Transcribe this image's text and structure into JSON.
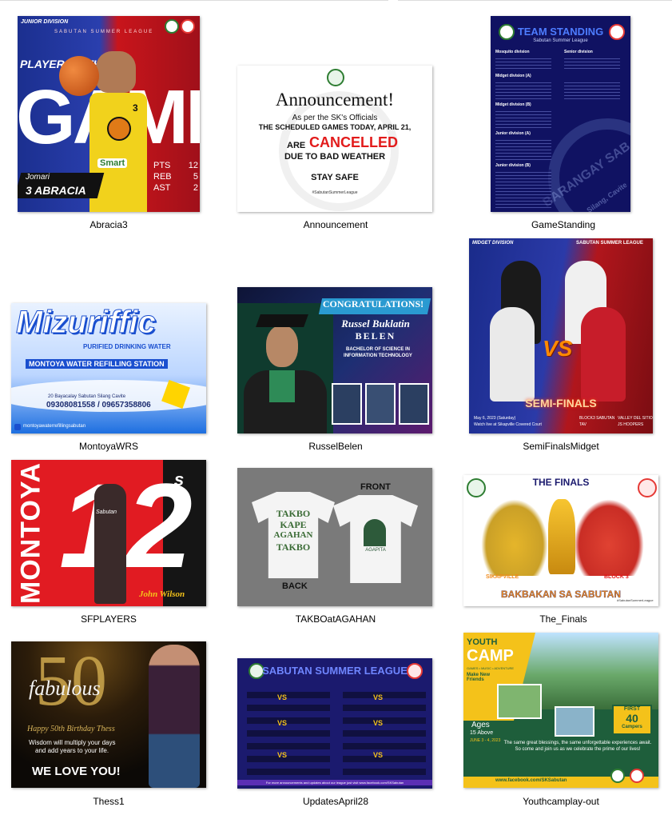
{
  "explorer": {
    "items": [
      {
        "name": "Abracia3",
        "art": {
          "division": "JUNIOR DIVISION",
          "league": "SABUTAN SUMMER LEAGUE",
          "headline": "PLAYER OF THE",
          "big_word": "GAME",
          "jersey_number": "3",
          "sponsor": "Smart",
          "first_name": "Jomari",
          "last_name": "3 ABRACIA",
          "stats": [
            {
              "label": "PTS",
              "value": "12"
            },
            {
              "label": "REB",
              "value": "5"
            },
            {
              "label": "AST",
              "value": "2"
            }
          ]
        }
      },
      {
        "name": "Announcement",
        "art": {
          "title": "Announcement!",
          "line1": "As per the SK's Officials",
          "line2": "THE SCHEDULED GAMES TODAY, APRIL 21,",
          "are": "ARE",
          "cancelled": "CANCELLED",
          "reason": "DUE TO BAD WEATHER",
          "stay_safe": "STAY SAFE",
          "hashtag": "#SabutanSummerLeague"
        }
      },
      {
        "name": "GameStanding",
        "art": {
          "title": "TEAM STANDING",
          "subtitle": "Sabutan Summer League",
          "watermark": "BARANGAY SAB",
          "location": "Silang, Cavite",
          "divisions": [
            "Mosquito division",
            "Senior division",
            "Midget division (A)",
            "Midget division (B)",
            "Junior division (A)",
            "Junior division (B)"
          ]
        }
      },
      {
        "name": "MontoyaWRS",
        "art": {
          "brand": "Mizuriffic",
          "tagline": "PURIFIED DRINKING WATER",
          "station": "MONTOYA WATER REFILLING STATION",
          "address": "20 Bayacalay Sabutan Silang Cavite",
          "phones": "09308081558 / 09657358806",
          "facebook": "montoyawaterrefillingsabutan"
        }
      },
      {
        "name": "RusselBelen",
        "art": {
          "congrats": "CONGRATULATIONS!",
          "name_script": "Russel Buklatin",
          "surname": "BELEN",
          "degree": "BACHELOR OF SCIENCE IN INFORMATION TECHNOLOGY"
        }
      },
      {
        "name": "SemiFinalsMidget",
        "art": {
          "division": "MIDGET DIVISION",
          "league": "SABUTAN SUMMER LEAGUE",
          "versus": "VS",
          "stage": "SEMI-FINALS",
          "date": "May 6, 2023 (Saturday)",
          "venue": "Watch live at Sikapville Covered Court",
          "team_a": "BLOCK3 SABUTAN",
          "team_b": "VALLEY DEL SITIO",
          "team_a_sub": "TAV",
          "team_b_sub": "JS HOOPERS"
        }
      },
      {
        "name": "SFPLAYERS",
        "art": {
          "surname": "MONTOYA",
          "number": "12",
          "player": "John Wilson",
          "jersey_text": "Sabutan"
        }
      },
      {
        "name": "TAKBOatAGAHAN",
        "art": {
          "front_label": "FRONT",
          "back_label": "BACK",
          "shirt_back_text": [
            "TAKBO",
            "KAPE",
            "AGAHAN",
            "TAKBO"
          ],
          "shirt_front_text": "AGAPITA"
        }
      },
      {
        "name": "The_Finals",
        "art": {
          "title": "THE FINALS",
          "team_left": "SIKAPVILLE",
          "team_right": "BLOCK 3",
          "banner": "BAKBAKAN SA SABUTAN",
          "hashtag": "#SabutanSummerLeague"
        }
      },
      {
        "name": "Thess1",
        "art": {
          "number": "50",
          "word": "fabulous",
          "greeting": "Happy 50th Birthday Thess",
          "wisdom1": "Wisdom will multiply your days",
          "wisdom2": "and add years to your life.",
          "love": "WE LOVE YOU!"
        }
      },
      {
        "name": "UpdatesApril28",
        "art": {
          "title": "SABUTAN SUMMER LEAGUE",
          "vs": "VS",
          "footer": "For more announcements and updates about our league just visit www.facebook.com/SKSabutan"
        }
      },
      {
        "name": "Youthcamplay-out",
        "art": {
          "youth": "YOUTH",
          "camp": "CAMP",
          "camp_sub": "GAMES • MUSIC • ADVENTURE",
          "make_new": "Make New Friends",
          "ages_label": "Ages",
          "ages_value": "15 Above",
          "date": "JUNE 3 - 4, 2023",
          "first": "FIRST",
          "first_count": "40",
          "campers": "Campers",
          "blessing": "The same great blessings, the same unforgettable experiences await. So come and join us as we celebrate the prime of our lives!",
          "facebook": "www.facebook.com/SKSabutan"
        }
      }
    ]
  },
  "colors": {
    "label_text": "#000000",
    "tile_shadow": "#bdbdbd",
    "league_navy": "#1b1a6e",
    "cancel_red": "#e21b1b",
    "finals_orange": "#f08a1c",
    "youth_green": "#1e5e3b",
    "youth_yellow": "#f4c21a"
  }
}
